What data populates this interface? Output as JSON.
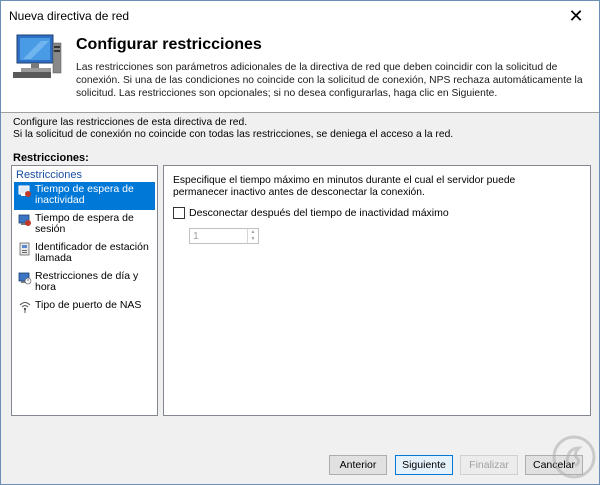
{
  "window": {
    "title": "Nueva directiva de red",
    "close_glyph": "✕"
  },
  "header": {
    "title": "Configurar restricciones",
    "description": "Las restricciones son parámetros adicionales de la directiva de red que deben coincidir con la solicitud de conexión. Si una de las condiciones no coincide con la solicitud de conexión, NPS rechaza automáticamente la solicitud. Las restricciones son opcionales; si no desea configurarlas, haga clic en Siguiente.",
    "icon": "network-computer-icon"
  },
  "intro": {
    "line1": "Configure las restricciones de esta directiva de red.",
    "line2": "Si la solicitud de conexión no coincide con todas las restricciones, se deniega el acceso a la red."
  },
  "restrictions_label": "Restricciones:",
  "left_panel": {
    "header": "Restricciones",
    "items": [
      {
        "label": "Tiempo de espera de inactividad",
        "icon": "idle-timeout-icon",
        "selected": true
      },
      {
        "label": "Tiempo de espera de sesión",
        "icon": "session-timeout-icon",
        "selected": false
      },
      {
        "label": "Identificador de estación llamada",
        "icon": "station-id-icon",
        "selected": false
      },
      {
        "label": "Restricciones de día y hora",
        "icon": "day-time-icon",
        "selected": false
      },
      {
        "label": "Tipo de puerto de NAS",
        "icon": "nas-port-icon",
        "selected": false
      }
    ]
  },
  "right_panel": {
    "description": "Especifique el tiempo máximo en minutos durante el cual el servidor puede permanecer inactivo antes de desconectar la conexión.",
    "checkbox_label": "Desconectar después del tiempo de inactividad máximo",
    "checkbox_checked": false,
    "spinner_value": "1"
  },
  "buttons": {
    "back": "Anterior",
    "next": "Siguiente",
    "finish": "Finalizar",
    "cancel": "Cancelar"
  },
  "colors": {
    "selection": "#0078d7",
    "header_link": "#1a4ea1"
  }
}
